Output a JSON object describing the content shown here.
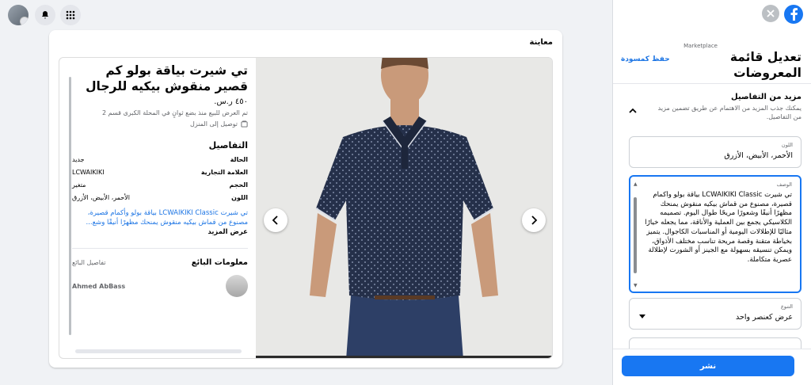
{
  "top_bar": {
    "avatar_icon": "user-avatar",
    "notifications_icon": "bell-icon",
    "menu_icon": "grid-menu-icon"
  },
  "preview": {
    "title": "معاينة",
    "product": {
      "title": "تي شيرت بياقة بولو كم قصير منقوش بيكيه للرجال",
      "price": "٤٥٠ ر.س.",
      "listed_meta": "تم العرض للبيع منذ بضع ثوانٍ في المحلة الكبرى قسم 2",
      "delivery": "توصيل إلى المنزل",
      "details_heading": "التفاصيل",
      "details": [
        {
          "key": "الحالة",
          "value": "جديد"
        },
        {
          "key": "العلامة التجارية",
          "value": "LCWAIKIKI"
        },
        {
          "key": "الحجم",
          "value": "متغير"
        },
        {
          "key": "اللون",
          "value": "الأحمر، الأبيض، الأزرق"
        }
      ],
      "description_preview": "تي شيرت LCWAIKIKI Classic بياقة بولو وأكمام قصيرة، مصنوع من قماش بيكيه منقوش يمنحك مظهرًا أنيقًا وشع...",
      "see_more": "عرض المزيد",
      "seller_heading": "معلومات البائع",
      "seller_details_link": "تفاصيل البائع",
      "seller_name": "Ahmed AbBass"
    }
  },
  "panel": {
    "breadcrumb": "Marketplace",
    "title": "تعديل قائمة المعروضات",
    "save_draft": "حفظ كمسودة",
    "more_details_heading": "مزيد من التفاصيل",
    "more_details_sub": "يمكنك جذب المزيد من الاهتمام عن طريق تضمين مزيد من التفاصيل.",
    "color_label": "اللون",
    "color_value": "الأحمر، الأبيض، الأزرق",
    "description_label": "الوصف",
    "description_value": "تي شيرت LCWAIKIKI Classic بياقة بولو وأكمام قصيرة، مصنوع من قماش بيكيه منقوش يمنحك مظهرًا أنيقًا وشعورًا مريحًا طوال اليوم. تصميمه الكلاسيكي يجمع بين العملية والأناقة، مما يجعله خيارًا مثاليًا للإطلالات اليومية أو المناسبات الكاجوال. يتميز بخياطة متقنة وقصة مريحة تناسب مختلف الأذواق، ويمكن تنسيقه بسهولة مع الجينز أو الشورت لإطلالة عصرية متكاملة.",
    "variation_label": "التنوع",
    "variation_value": "عرض كعنصر واحد",
    "publish": "نشر"
  }
}
